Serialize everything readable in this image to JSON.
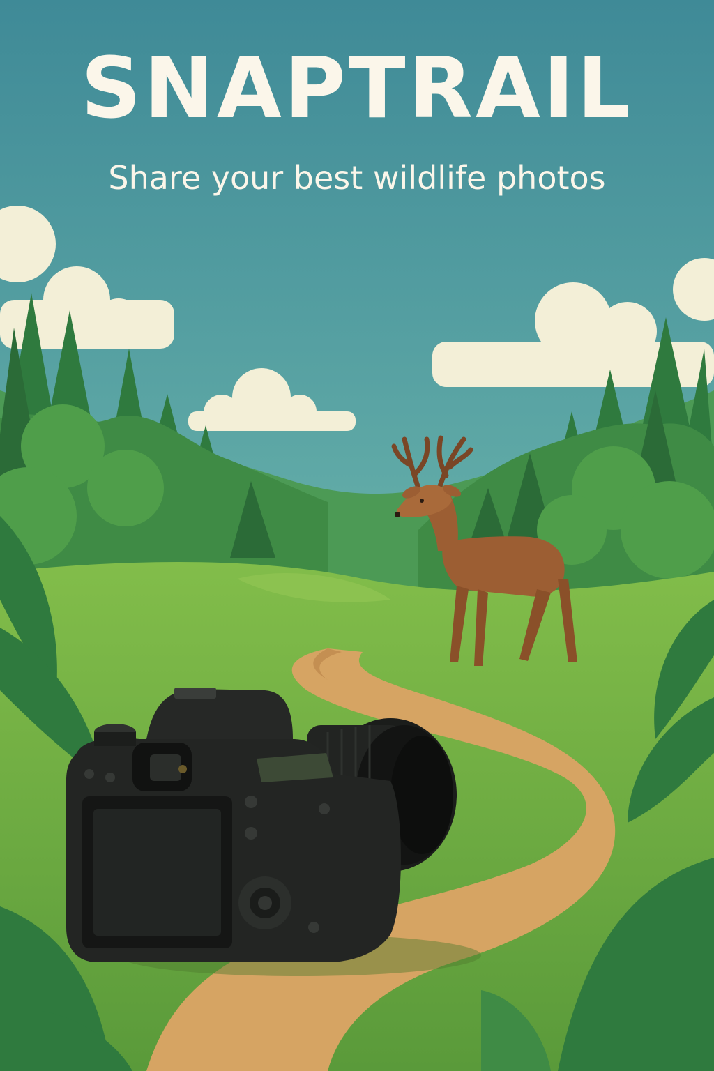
{
  "poster": {
    "title": "SNAPTRAIL",
    "tagline": "Share your best wildlife photos"
  },
  "colors": {
    "sky_top": "#3f8a97",
    "sky_bottom": "#8fd0ba",
    "title_text": "#fbf6ea",
    "forest_dark": "#2f6e3a",
    "forest_mid": "#3f8b45",
    "meadow": "#79b443",
    "trail": "#d6a463",
    "deer": "#9c5e33",
    "camera": "#1d1f1d"
  },
  "scene": {
    "subject": "deer-icon",
    "foreground": "camera-icon"
  }
}
